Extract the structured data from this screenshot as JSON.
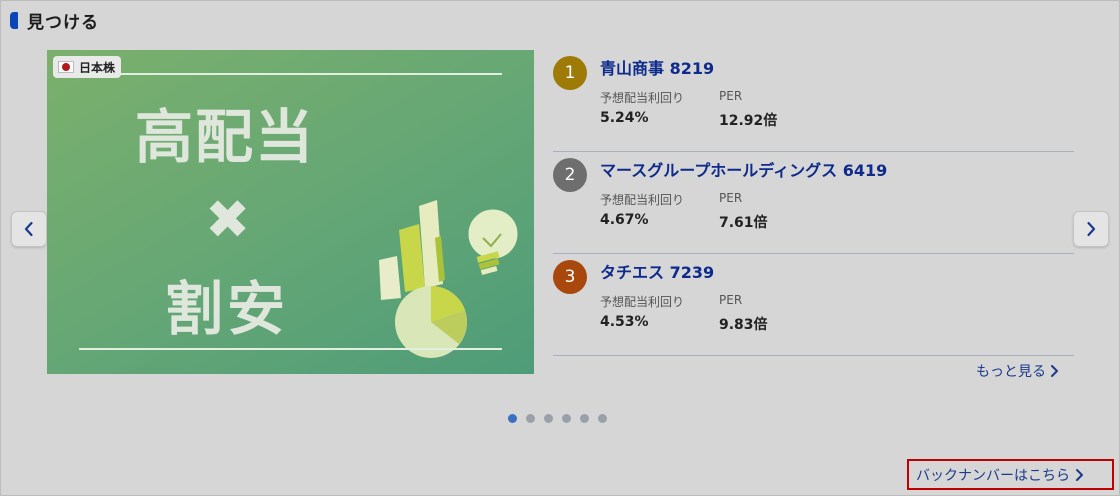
{
  "section": {
    "title": "見つける",
    "accent": "#0a46b8"
  },
  "banner": {
    "market_badge": "日本株",
    "line1": "高配当",
    "line2": "✖",
    "line3": "割安"
  },
  "rankings": [
    {
      "rank": "1",
      "name": "青山商事 8219",
      "dividend_label": "予想配当利回り",
      "dividend": "5.24%",
      "per_label": "PER",
      "per": "12.92倍",
      "badge_color": "#9e7a06"
    },
    {
      "rank": "2",
      "name": "マースグループホールディングス 6419",
      "dividend_label": "予想配当利回り",
      "dividend": "4.67%",
      "per_label": "PER",
      "per": "7.61倍",
      "badge_color": "#6e6e6e"
    },
    {
      "rank": "3",
      "name": "タチエス 7239",
      "dividend_label": "予想配当利回り",
      "dividend": "4.53%",
      "per_label": "PER",
      "per": "9.83倍",
      "badge_color": "#a8480c"
    }
  ],
  "more_link": "もっと見る",
  "pagination": {
    "total": 6,
    "current": 1
  },
  "backnumber_link": "バックナンバーはこちら",
  "icons": {
    "prev": "chevron-left-icon",
    "next": "chevron-right-icon"
  }
}
